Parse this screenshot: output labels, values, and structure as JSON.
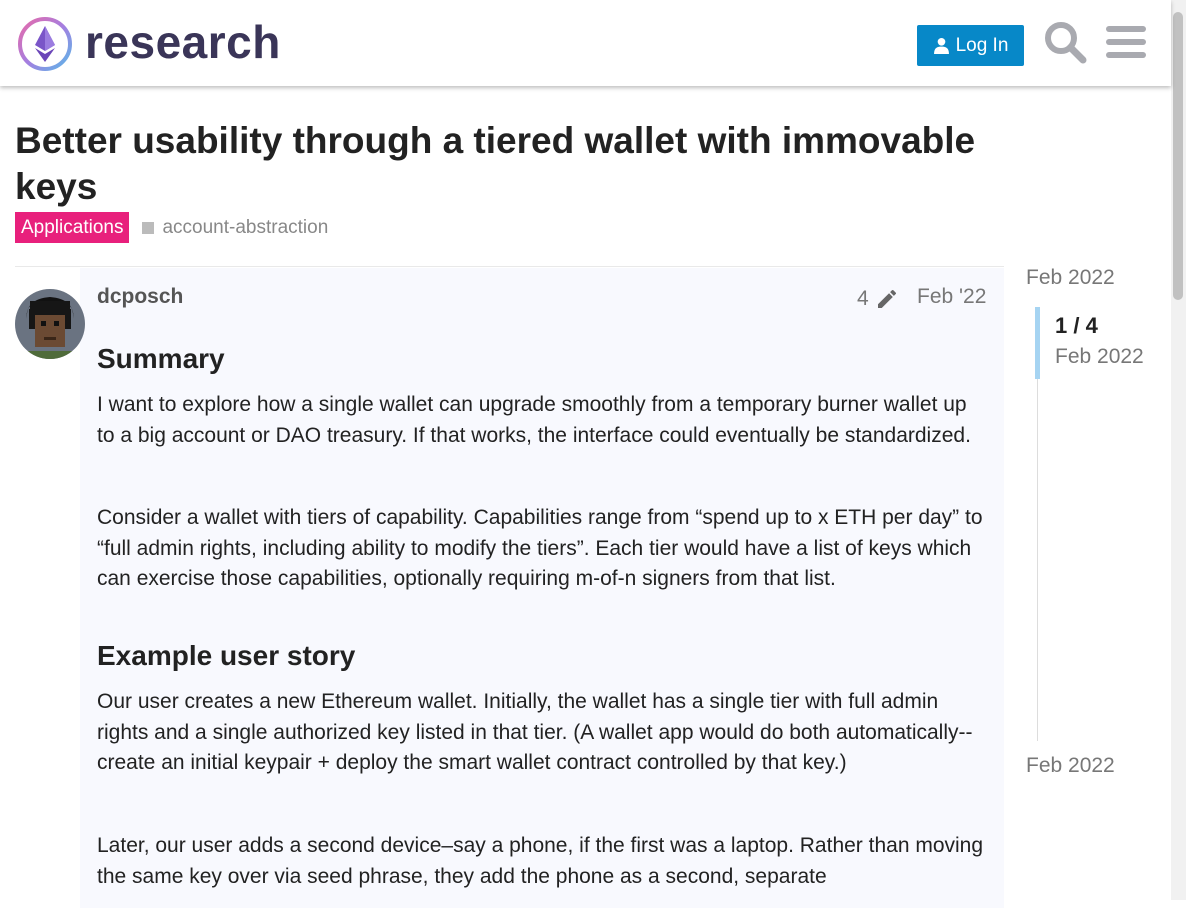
{
  "header": {
    "logo_text": "research",
    "login_label": "Log In",
    "search_icon": "search-icon",
    "menu_icon": "hamburger-menu-icon"
  },
  "topic": {
    "title": "Better usability through a tiered wallet with immovable keys",
    "category": "Applications",
    "category_color": "#e8207c",
    "tag": "account-abstraction"
  },
  "post": {
    "username": "dcposch",
    "edit_count": "4",
    "date": "Feb '22",
    "heading_summary": "Summary",
    "paragraph_1": "I want to explore how a single wallet can upgrade smoothly from a temporary burner wallet up to a big account or DAO treasury. If that works, the interface could eventually be standardized.",
    "paragraph_2": "Consider a wallet with tiers of capability. Capabilities range from “spend up to x ETH per day” to “full admin rights, including ability to modify the tiers”. Each tier would have a list of keys which can exercise those capabilities, optionally requiring m-of-n signers from that list.",
    "heading_story": "Example user story",
    "paragraph_3": "Our user creates a new Ethereum wallet. Initially, the wallet has a single tier with full admin rights and a single authorized key listed in that tier. (A wallet app would do both automatically-- create an initial keypair + deploy the smart wallet contract controlled by that key.)",
    "paragraph_4": "Later, our user adds a second device–say a phone, if the first was a laptop. Rather than moving the same key over via seed phrase, they add the phone as a second, separate"
  },
  "timeline": {
    "start_date": "Feb 2022",
    "position": "1 / 4",
    "position_date": "Feb 2022",
    "end_date": "Feb 2022"
  },
  "colors": {
    "accent": "#0788c8",
    "timeline_handle": "#a6d4f2",
    "post_background": "#f8f9fe"
  }
}
